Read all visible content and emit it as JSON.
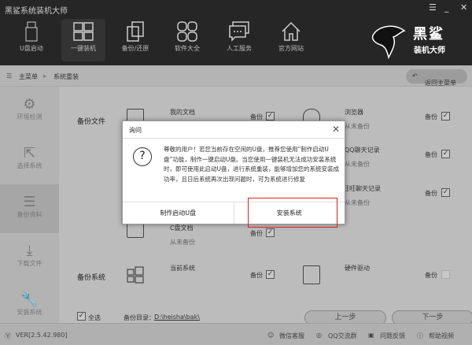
{
  "window": {
    "title": "黑鲨系统装机大师",
    "menu": "☰",
    "minimize": "_",
    "close": "✕"
  },
  "nav": [
    {
      "label": "U盘启动"
    },
    {
      "label": "一键装机"
    },
    {
      "label": "备份/还原"
    },
    {
      "label": "软件大全"
    },
    {
      "label": "人工服务"
    },
    {
      "label": "官方网站"
    }
  ],
  "logo": {
    "line1": "黑鲨",
    "line2": "装机大师"
  },
  "breadcrumb": {
    "home": "主菜单",
    "current": "系统重装",
    "back": "返回主菜单"
  },
  "sidebar": [
    {
      "label": "环境检测"
    },
    {
      "label": "选择系统"
    },
    {
      "label": "备份资料"
    },
    {
      "label": "下载文件"
    },
    {
      "label": "安装系统"
    }
  ],
  "backup": {
    "files_title": "备份文件",
    "system_title": "备份系统",
    "backup_label": "备份",
    "items": [
      {
        "name": "我的文档",
        "status": "",
        "checked": true
      },
      {
        "name": "浏览器",
        "status": "从未备份",
        "checked": true
      },
      {
        "name": "QQ聊天记录",
        "status": "从未备份",
        "checked": true
      },
      {
        "name": "阿里旺旺聊天记录",
        "status": "从未备份",
        "checked": true
      },
      {
        "name": "C盘文档",
        "status": "从未备份",
        "checked": true
      },
      {
        "name": "当前系统",
        "status": "",
        "checked": true
      },
      {
        "name": "硬件驱动",
        "status": "",
        "checked": false
      }
    ],
    "select_all": "全选",
    "dir_label": "备份目录：",
    "dir_path": "D:\\heisha\\bak\\",
    "prev": "上一步",
    "next": "下一步"
  },
  "footer": {
    "version": "VER[2.5.42.980]",
    "links": [
      "微信客服",
      "QQ交流群",
      "问题反馈",
      "帮助视频"
    ]
  },
  "dialog": {
    "title": "询问",
    "close": "✕",
    "message": "尊敬的用户！若您当前存在空闲的U盘，推荐您使用“制作启动U盘”功能，制作一键启动U盘。当您使用一键装机无法成功安装系统时，即可使用此启动U盘，进行系统重装，能够增加您的系统安装成功率，且日后系统再次出现问题时，可为系统进行修复",
    "btn_make": "制作启动U盘",
    "btn_install": "安装系统"
  }
}
